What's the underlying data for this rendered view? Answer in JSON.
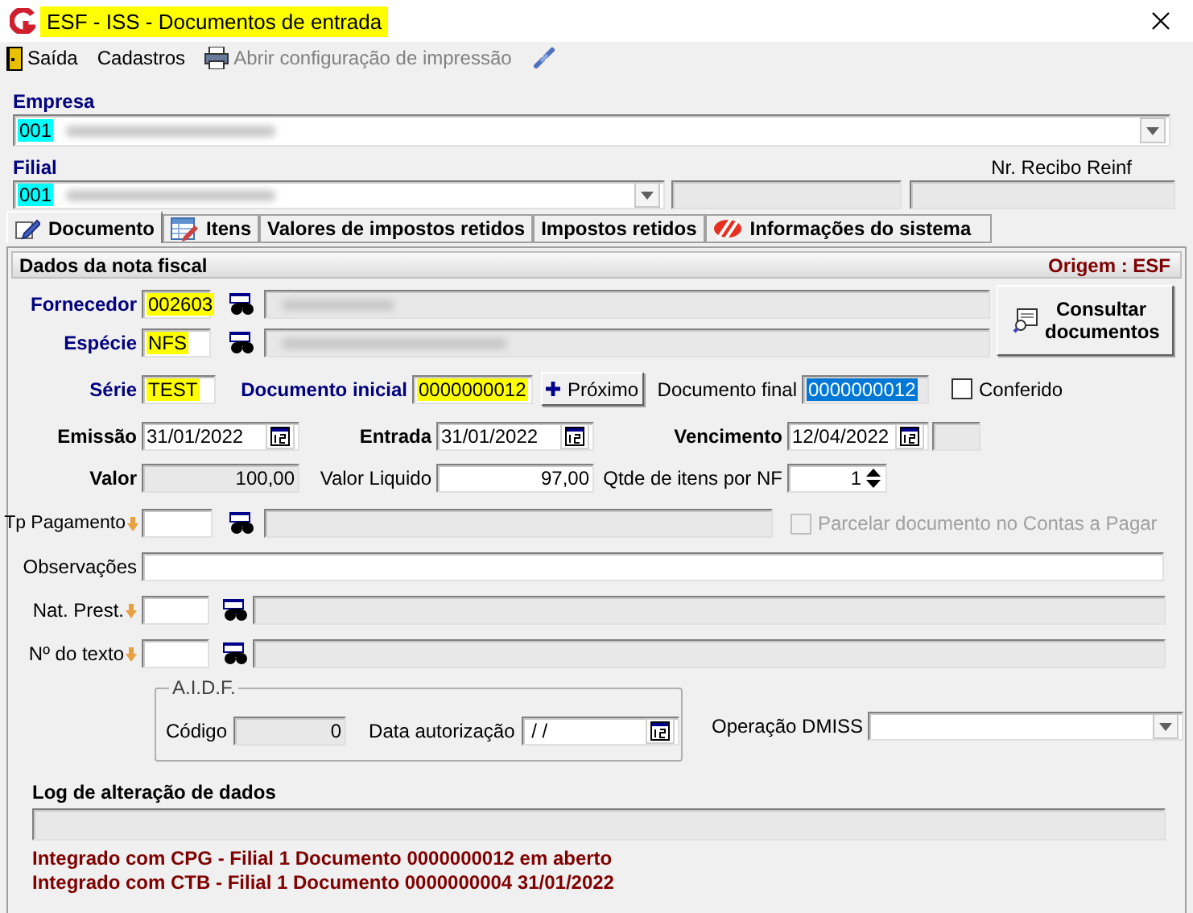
{
  "window": {
    "title": "ESF - ISS - Documentos de entrada"
  },
  "toolbar": [
    {
      "label": "Saída",
      "kind": "exit",
      "disabled": false
    },
    {
      "label": "Cadastros",
      "kind": "text",
      "disabled": false
    },
    {
      "label": "Abrir configuração de impressão",
      "kind": "print",
      "disabled": true
    }
  ],
  "empresa": {
    "label": "Empresa",
    "code": "001"
  },
  "filial": {
    "label": "Filial",
    "code": "001"
  },
  "nr_recibo_reinf": {
    "label": "Nr. Recibo Reinf"
  },
  "tabs": [
    {
      "label": "Documento",
      "kind": "pencil",
      "selected": true
    },
    {
      "label": "Itens",
      "kind": "grid",
      "selected": false
    },
    {
      "label": "Valores de impostos retidos",
      "kind": "none",
      "selected": false
    },
    {
      "label": "Impostos retidos",
      "kind": "none",
      "selected": false
    },
    {
      "label": "Informações do sistema",
      "kind": "logo",
      "selected": false
    }
  ],
  "section": {
    "title": "Dados da nota fiscal",
    "origin": "Origem : ESF"
  },
  "fornecedor": {
    "label": "Fornecedor",
    "value": "002603",
    "highlighted": true
  },
  "especie": {
    "label": "Espécie",
    "value": "NFS",
    "highlighted": true
  },
  "consultar_button": {
    "label": "Consultar documentos"
  },
  "serie": {
    "label": "Série",
    "value": "TEST",
    "highlighted": true
  },
  "documento_inicial": {
    "label": "Documento inicial",
    "value": "0000000012",
    "highlighted": true
  },
  "proximo_button": {
    "label": "Próximo"
  },
  "documento_final": {
    "label": "Documento final",
    "value": "0000000012",
    "selected": true
  },
  "conferido": {
    "label": "Conferido",
    "checked": false
  },
  "emissao": {
    "label": "Emissão",
    "value": "31/01/2022"
  },
  "entrada": {
    "label": "Entrada",
    "value": "31/01/2022"
  },
  "vencimento": {
    "label": "Vencimento",
    "value": "12/04/2022"
  },
  "valor": {
    "label": "Valor",
    "value": "100,00"
  },
  "valor_liquido": {
    "label": "Valor Liquido",
    "value": "97,00"
  },
  "qtde": {
    "label": "Qtde de itens por NF",
    "value": "1"
  },
  "tp_pagamento": {
    "label": "Tp Pagamento"
  },
  "parcelar": {
    "label": "Parcelar documento no Contas a Pagar",
    "checked": false,
    "disabled": true
  },
  "observacoes": {
    "label": "Observações"
  },
  "nat_prest": {
    "label": "Nat. Prest."
  },
  "numero_texto": {
    "label": "Nº do texto"
  },
  "aidf": {
    "title": "A.I.D.F.",
    "codigo_label": "Código",
    "codigo_value": "0",
    "data_label": "Data autorização",
    "data_value": "/ /"
  },
  "operacao_dmiss": {
    "label": "Operação DMISS"
  },
  "log": {
    "title": "Log de alteração de dados",
    "lines": [
      "Integrado com CPG - Filial 1 Documento 0000000012 em aberto",
      "Integrado com CTB - Filial 1 Documento 0000000004 31/01/2022"
    ]
  }
}
